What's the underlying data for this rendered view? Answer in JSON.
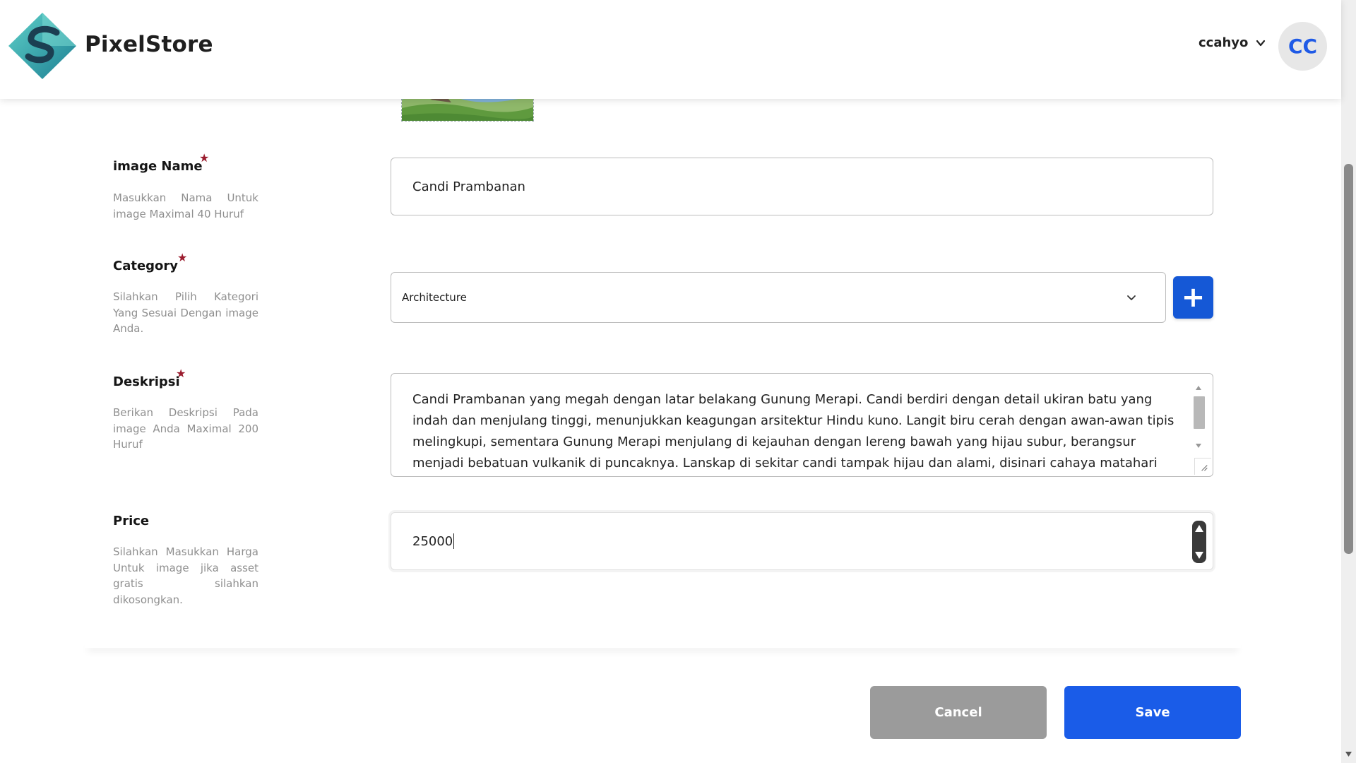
{
  "app": {
    "brand": "PixelStore"
  },
  "user": {
    "name": "ccahyo",
    "initials": "CC"
  },
  "form": {
    "image_name": {
      "title": "image Name",
      "required_mark": "★",
      "hint": "Masukkan Nama Untuk image Maximal 40 Huruf",
      "value": "Candi Prambanan"
    },
    "category": {
      "title": "Category",
      "required_mark": "★",
      "hint": "Silahkan Pilih Kategori Yang Sesuai Dengan image Anda.",
      "selected": "Architecture",
      "add_label": "+"
    },
    "description": {
      "title": "Deskripsi",
      "required_mark": "★",
      "hint": "Berikan Deskripsi Pada image Anda Maximal 200 Huruf",
      "value": "Candi Prambanan yang megah dengan latar belakang Gunung Merapi. Candi berdiri dengan detail ukiran batu yang indah dan menjulang tinggi, menunjukkan keagungan arsitektur Hindu kuno. Langit biru cerah dengan awan-awan tipis melingkupi, sementara Gunung Merapi menjulang di kejauhan dengan lereng bawah yang hijau subur, berangsur menjadi bebatuan vulkanik di puncaknya. Lanskap di sekitar candi tampak hijau dan alami, disinari cahaya matahari lembut yang"
    },
    "price": {
      "title": "Price",
      "hint": "Silahkan Masukkan Harga Untuk image jika asset gratis silahkan dikosongkan.",
      "value": "25000"
    }
  },
  "actions": {
    "cancel": "Cancel",
    "save": "Save"
  },
  "colors": {
    "primary": "#1a5ce8",
    "cancel": "#9b9b9b",
    "required": "#9b1c2e",
    "avatar_text": "#1f5ae6"
  },
  "icons": [
    "logo-icon",
    "chevron-down-icon",
    "plus-icon",
    "resize-handle-icon",
    "spinner-up-icon",
    "spinner-down-icon"
  ]
}
